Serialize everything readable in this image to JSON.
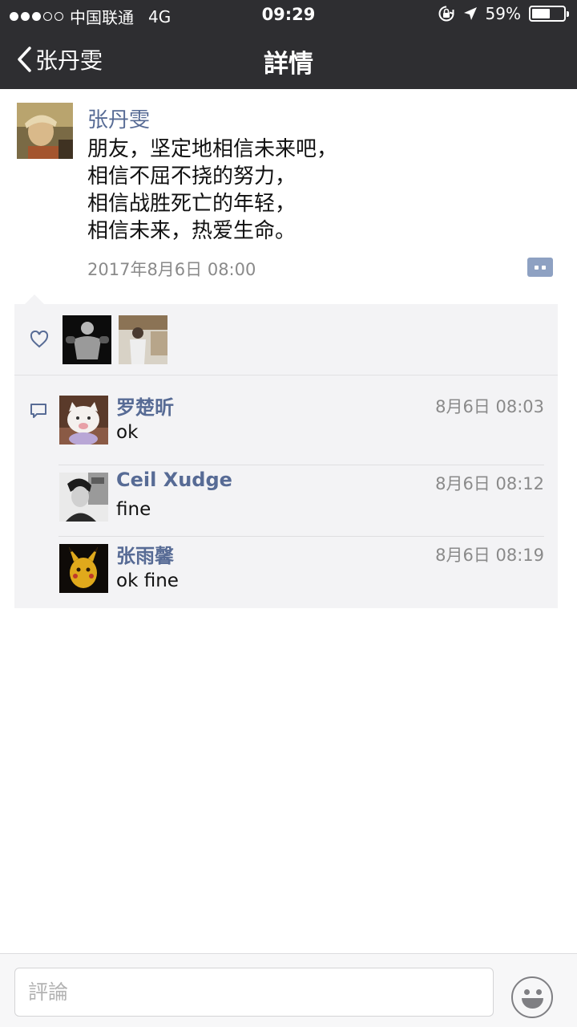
{
  "status_bar": {
    "carrier": "中国联通",
    "network": "4G",
    "time": "09:29",
    "battery_percent": "59%",
    "battery_level": 0.59,
    "signal_bars_filled": 3,
    "signal_bars_total": 5
  },
  "nav": {
    "back_label": "张丹雯",
    "title": "詳情"
  },
  "post": {
    "author": "张丹雯",
    "text": "朋友，坚定地相信未来吧，\n相信不屈不挠的努力，\n相信战胜死亡的年轻，\n相信未来，热爱生命。",
    "time": "2017年8月6日 08:00"
  },
  "comments": [
    {
      "name": "罗楚昕",
      "time": "8月6日 08:03",
      "text": "ok"
    },
    {
      "name": "Ceil Xudge",
      "time": "8月6日 08:12",
      "text": "fine"
    },
    {
      "name": "张雨馨",
      "time": "8月6日 08:19",
      "text": "ok fine"
    }
  ],
  "comment_input": {
    "placeholder": "評論"
  },
  "colors": {
    "nav_background": "#2e2e31",
    "link_blue": "#576b95",
    "feedback_background": "#f3f3f5"
  }
}
